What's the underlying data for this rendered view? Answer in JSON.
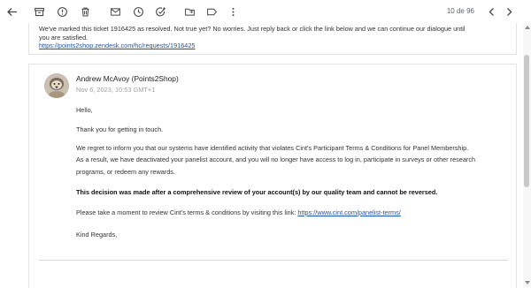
{
  "toolbar": {
    "back": "back-arrow-icon",
    "archive": "archive-icon",
    "report": "report-spam-icon",
    "delete": "trash-icon",
    "mark_unread": "mail-icon",
    "snooze": "clock-icon",
    "add_task": "add-task-icon",
    "move": "folder-icon",
    "label": "label-icon",
    "more": "more-vertical-icon",
    "pager": "10 de 96",
    "prev": "chevron-left-icon",
    "next": "chevron-right-icon"
  },
  "quoted": {
    "line1": "We've marked this ticket 1916425 as resolved. Not true yet? No worries. Just reply back or click the link below and we can continue our dialogue until",
    "line2": "you are satisfied.",
    "link": "https://points2shop.zendesk.com/hc/requests/1916425"
  },
  "message": {
    "sender": "Andrew McAvoy (Points2Shop)",
    "date": "Nov 6, 2023, 10:53 GMT+1",
    "greeting": "Hello,",
    "thanks": "Thank you for getting in touch.",
    "para1_line1": "We regret to inform you that our systems have identified activity that violates Cint's Participant Terms & Conditions for Panel Membership.",
    "para1_line2": "As a result, we have deactivated your panelist account, and you will no longer have access to log in, participate in surveys or other research",
    "para1_line3": "programs, or redeem any rewards.",
    "decision": "This decision was made after a comprehensive review of your account(s) by our quality team and cannot be reversed.",
    "review_text": "Please take a moment to review Cint's terms & conditions by visiting this link: ",
    "review_link": "https://www.cint.com/panelist-terms/",
    "signoff": "Kind Regards,"
  }
}
